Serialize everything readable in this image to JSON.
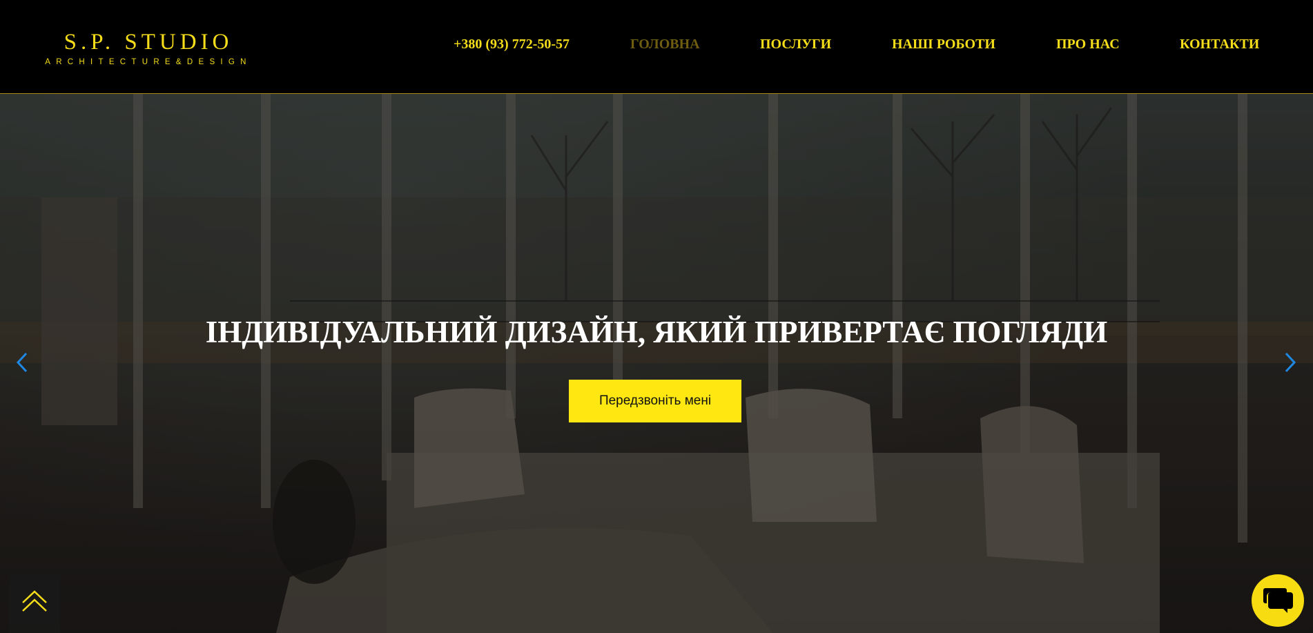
{
  "header": {
    "logo_title": "S.P. STUDIO",
    "logo_subtitle": "ARCHITECTURE&DESIGN",
    "phone": "+380 (93) 772-50-57",
    "nav": [
      {
        "label": "ГОЛОВНА",
        "active": true
      },
      {
        "label": "ПОСЛУГИ",
        "active": false
      },
      {
        "label": "НАШІ РОБОТИ",
        "active": false
      },
      {
        "label": "ПРО НАС",
        "active": false
      },
      {
        "label": "КОНТАКТИ",
        "active": false
      }
    ]
  },
  "hero": {
    "title": "ІНДИВІДУАЛЬНИЙ ДИЗАЙН, ЯКИЙ ПРИВЕРТАЄ ПОГЛЯДИ",
    "cta_label": "Передзвоніть мені",
    "background_image": "dark sunroom interior with sofa and large windows"
  },
  "icons": {
    "prev": "chevron-left-icon",
    "next": "chevron-right-icon",
    "scroll_top": "double-chevron-up-icon",
    "chat": "chat-icon"
  },
  "colors": {
    "accent": "#f5dd1a",
    "active_nav": "#6f5e10",
    "button": "#ffe812",
    "arrows": "#1e88e5",
    "header_bg": "#000000"
  }
}
